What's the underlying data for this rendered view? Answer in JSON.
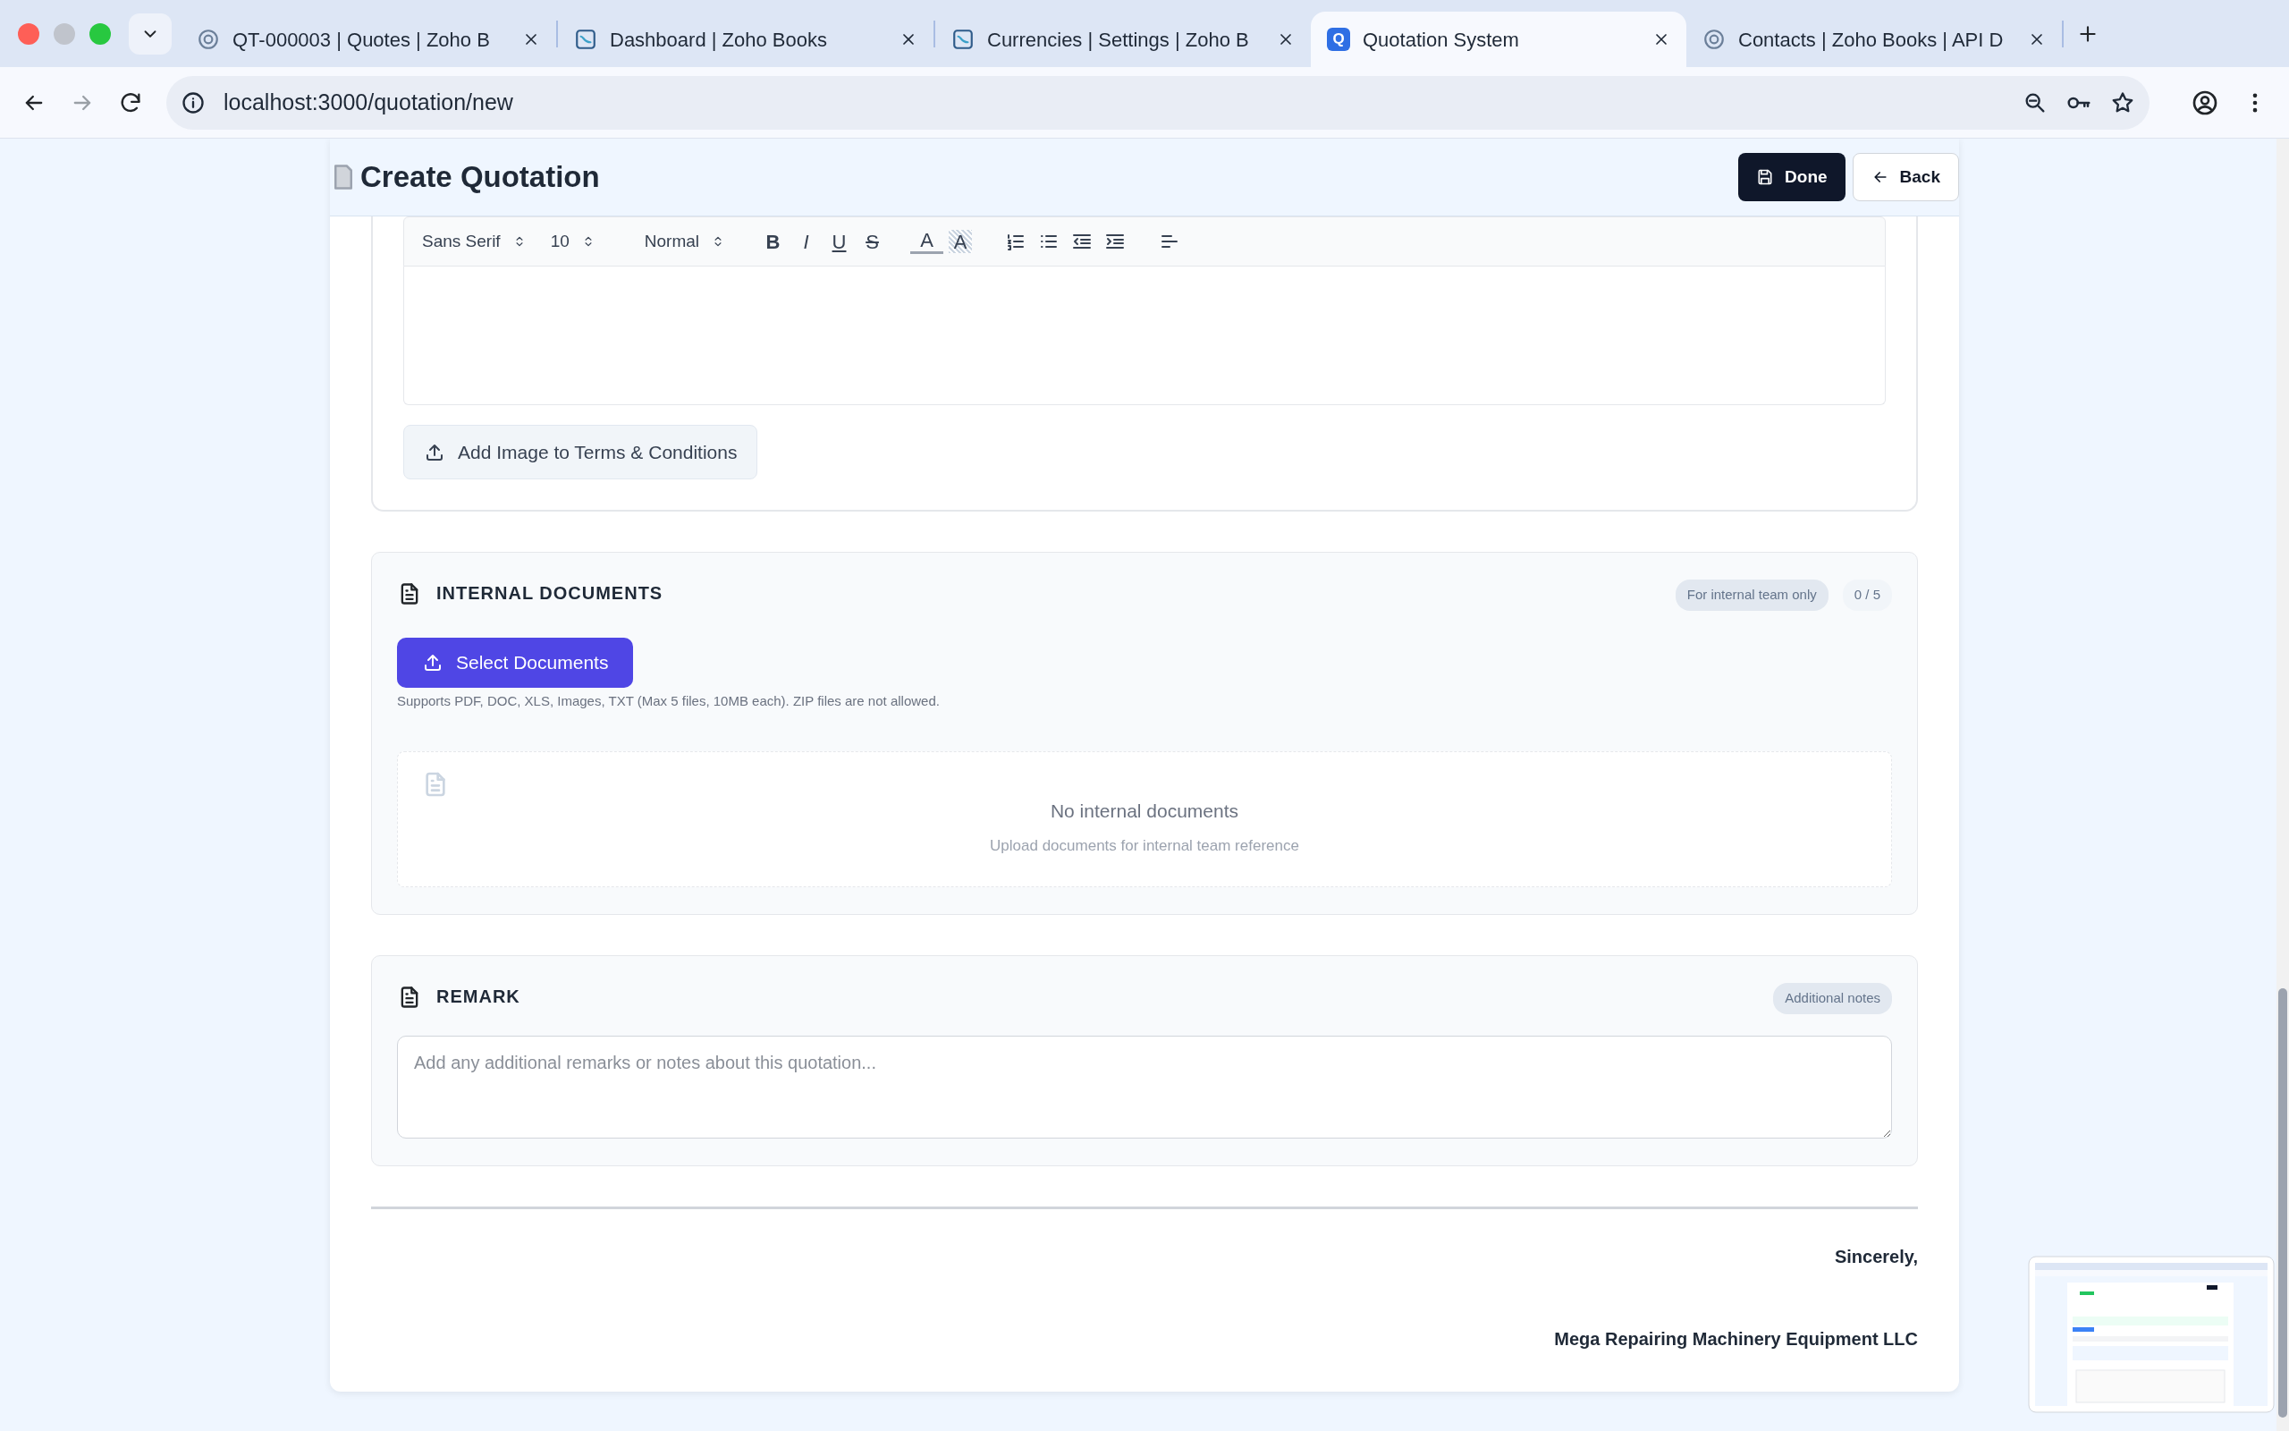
{
  "browser": {
    "tabs": [
      {
        "title": "QT-000003 | Quotes | Zoho B",
        "kind": "ring",
        "selected": false
      },
      {
        "title": "Dashboard | Zoho Books",
        "kind": "books",
        "selected": false
      },
      {
        "title": "Currencies | Settings | Zoho B",
        "kind": "books",
        "selected": false
      },
      {
        "title": "Quotation System",
        "kind": "letter",
        "letter": "Q",
        "selected": true
      },
      {
        "title": "Contacts | Zoho Books | API D",
        "kind": "ring",
        "selected": false
      }
    ],
    "address": "localhost:3000/quotation/new"
  },
  "header": {
    "title": "Create Quotation",
    "buttons": [
      {
        "label": "Done",
        "kind": "primary"
      },
      {
        "label": "Back",
        "kind": "outline"
      }
    ]
  },
  "editor": {
    "selects": [
      {
        "value": "Sans Serif"
      },
      {
        "value": "10"
      },
      {
        "value": "Normal"
      }
    ],
    "tools": [
      {
        "kind": "bold",
        "label": "B"
      },
      {
        "kind": "italic",
        "label": "I"
      },
      {
        "kind": "underline",
        "label": "U"
      },
      {
        "kind": "strike",
        "label": "S"
      },
      {
        "kind": "color",
        "label": "A"
      },
      {
        "kind": "background",
        "label": "A"
      },
      {
        "kind": "ordered-list"
      },
      {
        "kind": "bullet-list"
      },
      {
        "kind": "outdent"
      },
      {
        "kind": "indent"
      },
      {
        "kind": "align"
      }
    ],
    "image_button": "Add Image to Terms & Conditions"
  },
  "internal_documents": {
    "title": "INTERNAL DOCUMENTS",
    "badge": "For internal team only",
    "count": "0 / 5",
    "button": "Select Documents",
    "hint": "Supports PDF, DOC, XLS, Images, TXT (Max 5 files, 10MB each). ZIP files are not allowed.",
    "empty_title": "No internal documents",
    "empty_text": "Upload documents for internal team reference"
  },
  "remark": {
    "title": "REMARK",
    "badge": "Additional notes",
    "placeholder": "Add any additional remarks or notes about this quotation..."
  },
  "signature": {
    "closing": "Sincerely,",
    "company": "Mega Repairing Machinery Equipment LLC"
  }
}
